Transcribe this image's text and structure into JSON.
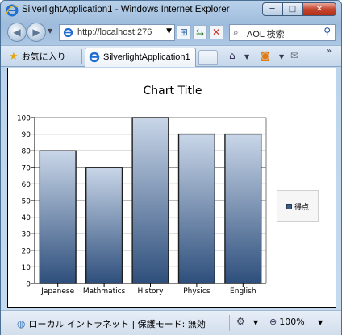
{
  "window": {
    "title": "SilverlightApplication1 - Windows Internet Explorer",
    "minimize_glyph": "─",
    "maximize_glyph": "□",
    "close_glyph": "✕"
  },
  "address_bar": {
    "url": "http://localhost:276",
    "dropdown_glyph": "▼"
  },
  "search": {
    "placeholder": "AOL 検索"
  },
  "favorites": {
    "label": "お気に入り"
  },
  "tab": {
    "label": "SilverlightApplication1"
  },
  "status_bar": {
    "zone_text": "ローカル イントラネット | 保護モード: 無効",
    "zoom": "100%"
  },
  "icons": {
    "back": "back-arrow-icon",
    "forward": "forward-arrow-icon",
    "search": "magnifier-icon",
    "home": "home-icon",
    "feeds": "rss-feed-icon",
    "mail": "mail-icon"
  },
  "colors": {
    "bar_top": "#c9d6e8",
    "bar_bottom": "#2e4f7c",
    "bar_border": "#1d1d1d",
    "accent": "#3e5c86"
  },
  "chart_data": {
    "type": "bar",
    "title": "Chart Title",
    "categories": [
      "Japanese",
      "Mathmatics",
      "History",
      "Physics",
      "English"
    ],
    "series": [
      {
        "name": "得点",
        "values": [
          80,
          70,
          100,
          90,
          90
        ]
      }
    ],
    "ylim": [
      0,
      100
    ],
    "yticks": [
      0,
      10,
      20,
      30,
      40,
      50,
      60,
      70,
      80,
      90,
      100
    ],
    "grid": true,
    "legend": "right"
  }
}
